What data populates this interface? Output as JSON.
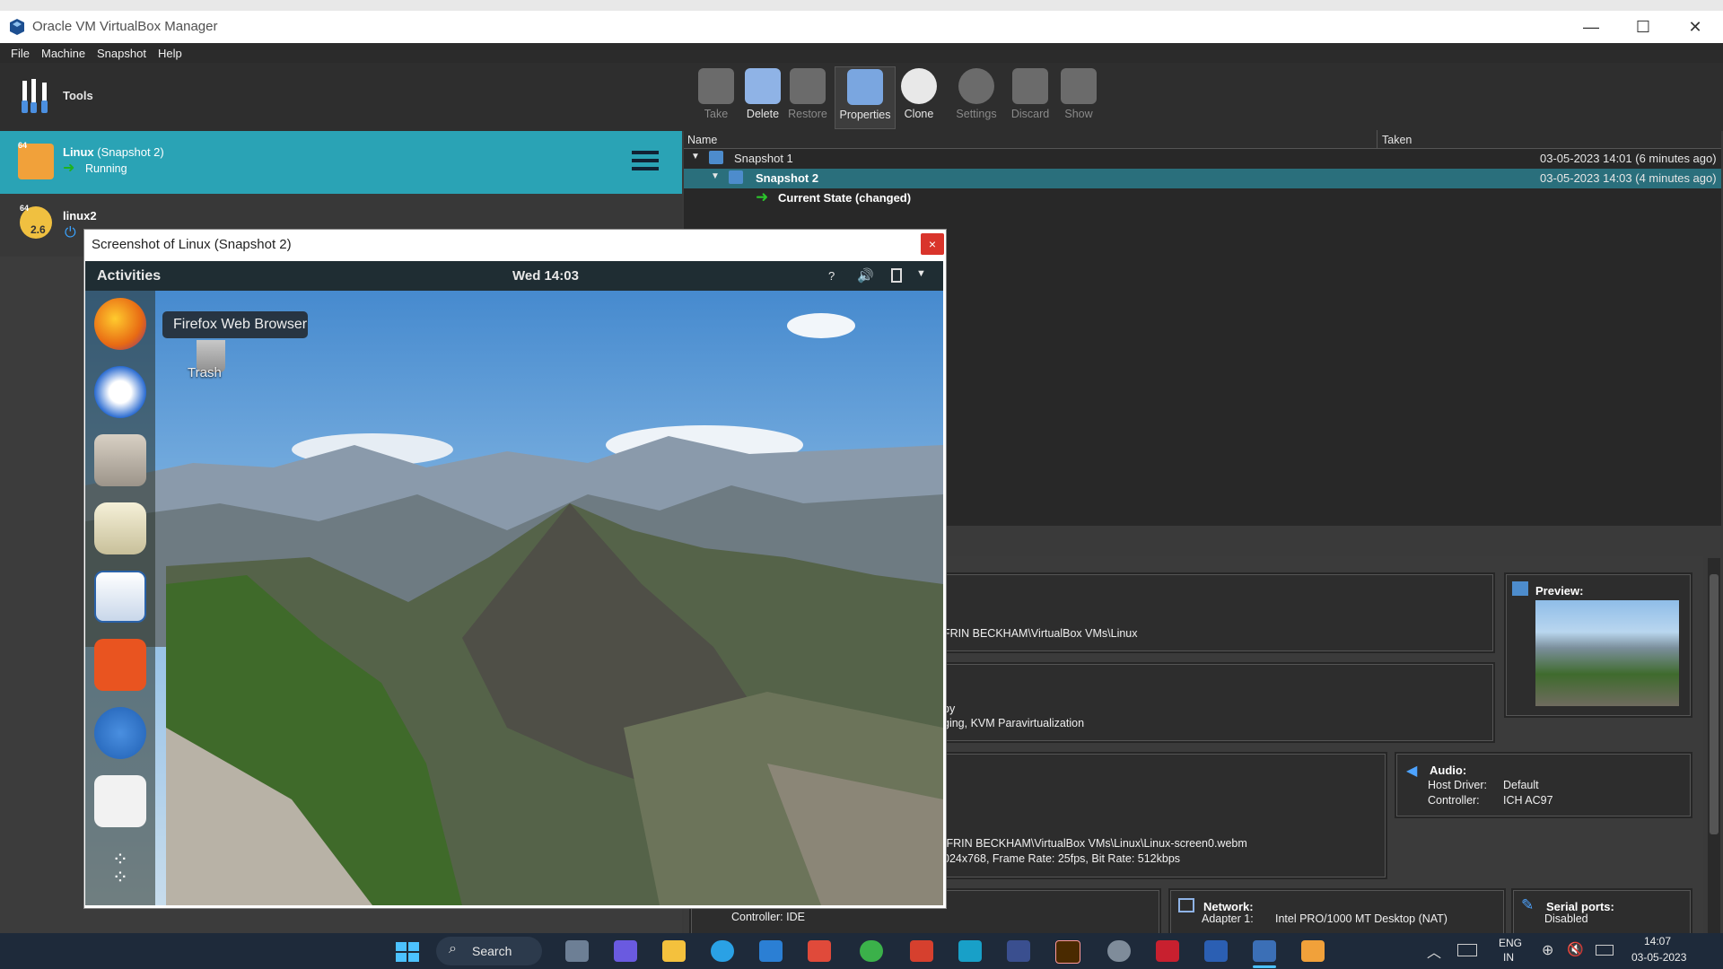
{
  "window": {
    "title": "Oracle VM VirtualBox Manager",
    "controls": [
      "—",
      "☐",
      "✕"
    ]
  },
  "menu": [
    "File",
    "Machine",
    "Snapshot",
    "Help"
  ],
  "tools": {
    "label": "Tools"
  },
  "vms": [
    {
      "name": "Linux",
      "snapshot": "(Snapshot 2)",
      "state": "Running",
      "badge": "64"
    },
    {
      "name": "linux2",
      "badge": "64",
      "version": "2.6"
    }
  ],
  "toolbar": [
    "Take",
    "Delete",
    "Restore",
    "Properties",
    "Clone",
    "Settings",
    "Discard",
    "Show"
  ],
  "snapshots": {
    "columns": [
      "Name",
      "Taken"
    ],
    "rows": [
      {
        "name": "Snapshot 1",
        "taken": "03-05-2023 14:01 (6 minutes ago)"
      },
      {
        "name": "Snapshot 2",
        "taken": "03-05-2023 14:03 (4 minutes ago)"
      },
      {
        "name": "Current State (changed)",
        "taken": ""
      }
    ]
  },
  "details": {
    "general_line": "FRIN BECKHAM\\VirtualBox VMs\\Linux",
    "system_line1": "py",
    "system_line2": "ging, KVM Paravirtualization",
    "preview": "Preview:",
    "audio": {
      "title": "Audio:",
      "host_label": "Host Driver:",
      "host_value": "Default",
      "ctrl_label": "Controller:",
      "ctrl_value": "ICH AC97"
    },
    "display_line1": "IFRIN BECKHAM\\VirtualBox VMs\\Linux\\Linux-screen0.webm",
    "display_line2": "024x768, Frame Rate: 25fps, Bit Rate: 512kbps",
    "storage_line": "Controller: IDE",
    "network": {
      "title": "Network:",
      "adapter_label": "Adapter 1:",
      "adapter_value": "Intel PRO/1000 MT Desktop (NAT)"
    },
    "serial": {
      "title": "Serial ports:",
      "value": "Disabled"
    }
  },
  "modal": {
    "title": "Screenshot of Linux (Snapshot 2)",
    "close": "×"
  },
  "guest": {
    "activities": "Activities",
    "clock": "Wed 14:03",
    "tooltip": "Firefox Web Browser",
    "trash": "Trash",
    "tray_help": "?"
  },
  "taskbar": {
    "search": "Search",
    "lang1": "ENG",
    "lang2": "IN",
    "time": "14:07",
    "date": "03-05-2023"
  }
}
